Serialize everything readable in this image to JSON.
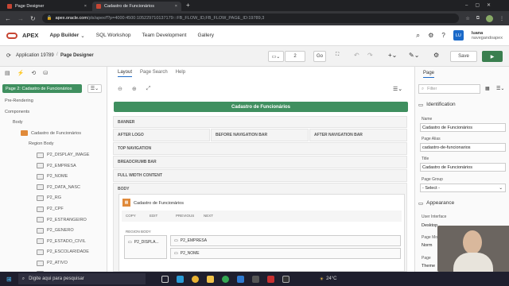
{
  "browser": {
    "tabs": [
      {
        "label": "Page Designer",
        "close": "×"
      },
      {
        "label": "Cadastro de Funcionários",
        "close": "×"
      }
    ],
    "new_tab": "+",
    "url_host": "apex.oracle.com",
    "url_path": "/pls/apex/f?p=4000:4500:105229710137179:::FB_FLOW_ID,FB_FLOW_PAGE_ID:19789,3"
  },
  "apex_header": {
    "logo_text": "APEX",
    "nav": [
      "App Builder",
      "SQL Workshop",
      "Team Development",
      "Gallery"
    ],
    "user_initials": "LU",
    "user_name": "luana",
    "user_workspace": "navegandoapex"
  },
  "toolbar": {
    "breadcrumb_app": "Application 19789",
    "breadcrumb_page": "Page Designer",
    "page_number": "2",
    "go_label": "Go",
    "save_label": "Save"
  },
  "left": {
    "page_label": "Page 2: Cadastro de Funcionários",
    "items": [
      {
        "label": "Pre-Rendering",
        "indent": 0
      },
      {
        "label": "Components",
        "indent": 0
      },
      {
        "label": "Body",
        "indent": 1
      },
      {
        "label": "Cadastro de Funcionários",
        "indent": 2
      },
      {
        "label": "Region Body",
        "indent": 3
      },
      {
        "label": "P2_DISPLAY_IMAGE",
        "indent": 4
      },
      {
        "label": "P2_EMPRESA",
        "indent": 4
      },
      {
        "label": "P2_NOME",
        "indent": 4
      },
      {
        "label": "P2_DATA_NASC",
        "indent": 4
      },
      {
        "label": "P2_RG",
        "indent": 4
      },
      {
        "label": "P2_CPF",
        "indent": 4
      },
      {
        "label": "P2_ESTRANGEIRO",
        "indent": 4
      },
      {
        "label": "P2_GENERO",
        "indent": 4
      },
      {
        "label": "P2_ESTADO_CIVIL",
        "indent": 4
      },
      {
        "label": "P2_ESCOLARIDADE",
        "indent": 4
      },
      {
        "label": "P2_ATIVO",
        "indent": 4
      },
      {
        "label": "P2_TELEFONE",
        "indent": 4
      }
    ]
  },
  "center": {
    "tabs": [
      "Layout",
      "Page Search",
      "Help"
    ],
    "title_bar": "Cadastro de Funcionários",
    "regions": {
      "banner": "BANNER",
      "after_logo": "AFTER LOGO",
      "before_nav": "BEFORE NAVIGATION BAR",
      "after_nav": "AFTER NAVIGATION BAR",
      "top_nav": "TOP NAVIGATION",
      "breadcrumb_bar": "BREADCRUMB BAR",
      "full_width": "FULL WIDTH CONTENT",
      "body": "BODY"
    },
    "card_title": "Cadastro de Funcionários",
    "card_buttons": [
      "COPY",
      "EDIT",
      "PREVIOUS",
      "NEXT"
    ],
    "region_body": "REGION BODY",
    "items": [
      "P2_DISPLA...",
      "P2_EMPRESA",
      "P2_NOME"
    ]
  },
  "right": {
    "tab": "Page",
    "filter_placeholder": "Filter",
    "section_identification": "Identification",
    "name_label": "Name",
    "name_value": "Cadastro de Funcionários",
    "alias_label": "Page Alias",
    "alias_value": "cadastro-de-funcionarios",
    "title_label": "Title",
    "title_value": "Cadastro de Funcionários",
    "group_label": "Page Group",
    "group_value": "- Select -",
    "section_appearance": "Appearance",
    "ui_label": "User Interface",
    "ui_value": "Desktop",
    "mode_label": "Page Mode",
    "mode_value": "Norm",
    "template_label": "Page",
    "template_value": "Theme"
  },
  "taskbar": {
    "search_placeholder": "Digite aqui para pesquisar",
    "temperature": "24°C"
  },
  "colors": {
    "apex_red": "#c74634",
    "region_green": "#3f8f5f",
    "user_blue": "#1b6ac9"
  }
}
